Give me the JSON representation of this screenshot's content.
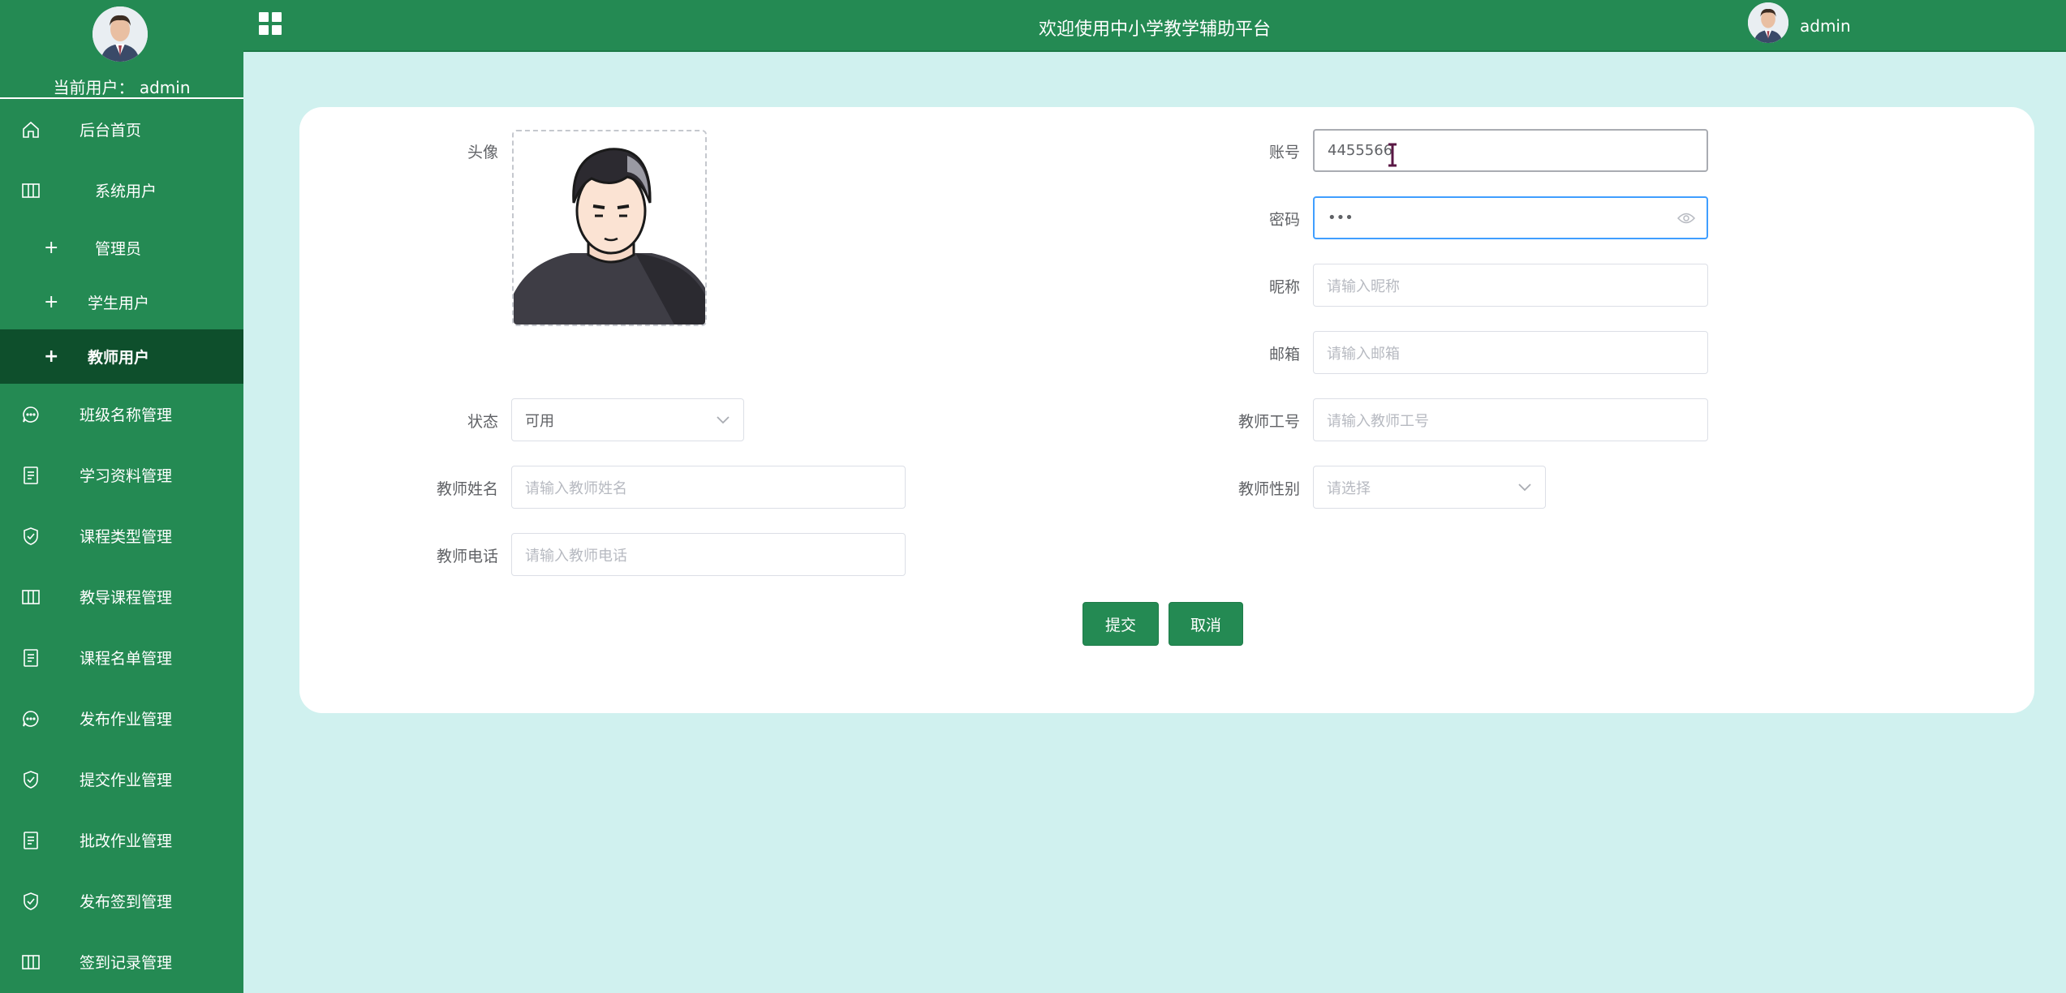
{
  "sidebar": {
    "current_user_label": "当前用户：",
    "current_user_name": "admin",
    "items": [
      {
        "label": "后台首页",
        "icon": "home-icon"
      },
      {
        "label": "系统用户",
        "icon": "table-icon"
      },
      {
        "label": "管理员",
        "icon": "plus-icon"
      },
      {
        "label": "学生用户",
        "icon": "plus-icon"
      },
      {
        "label": "教师用户",
        "icon": "plus-icon",
        "active": true
      },
      {
        "label": "班级名称管理",
        "icon": "chat-icon"
      },
      {
        "label": "学习资料管理",
        "icon": "document-icon"
      },
      {
        "label": "课程类型管理",
        "icon": "shield-check-icon"
      },
      {
        "label": "教导课程管理",
        "icon": "table-icon"
      },
      {
        "label": "课程名单管理",
        "icon": "document-icon"
      },
      {
        "label": "发布作业管理",
        "icon": "chat-icon"
      },
      {
        "label": "提交作业管理",
        "icon": "shield-check-icon"
      },
      {
        "label": "批改作业管理",
        "icon": "document-icon"
      },
      {
        "label": "发布签到管理",
        "icon": "shield-check-icon"
      },
      {
        "label": "签到记录管理",
        "icon": "table-icon"
      }
    ]
  },
  "header": {
    "title": "欢迎使用中小学教学辅助平台",
    "user": "admin"
  },
  "form": {
    "avatar_label": "头像",
    "account_label": "账号",
    "account_value": "4455566",
    "password_label": "密码",
    "password_value": "•••",
    "nickname_label": "昵称",
    "nickname_placeholder": "请输入昵称",
    "email_label": "邮箱",
    "email_placeholder": "请输入邮箱",
    "status_label": "状态",
    "status_value": "可用",
    "teacher_no_label": "教师工号",
    "teacher_no_placeholder": "请输入教师工号",
    "teacher_name_label": "教师姓名",
    "teacher_name_placeholder": "请输入教师姓名",
    "teacher_gender_label": "教师性别",
    "teacher_gender_placeholder": "请选择",
    "teacher_phone_label": "教师电话",
    "teacher_phone_placeholder": "请输入教师电话",
    "submit_label": "提交",
    "cancel_label": "取消"
  },
  "colors": {
    "primary": "#248a53",
    "active_menu": "#0e4f2c",
    "background": "#d0f1ef",
    "focus_border": "#409eff"
  }
}
